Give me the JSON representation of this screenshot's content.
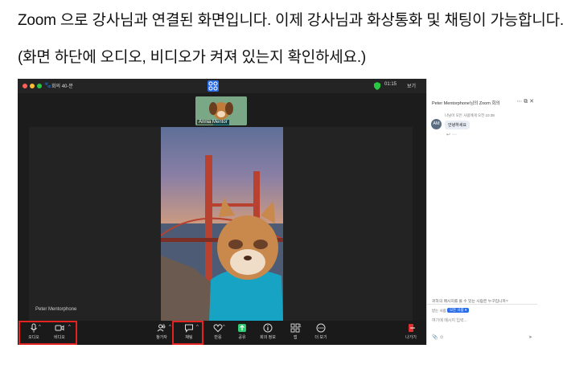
{
  "instructions": {
    "line1": "Zoom 으로 강사님과 연결된 화면입니다. 이제 강사님과 화상통화 및 채팅이 가능합니다.",
    "line2": "(화면 하단에 오디오, 비디오가 켜져 있는지 확인하세요.)"
  },
  "titlebar": {
    "timer": "회의 40-분",
    "clock": "01:15",
    "view": "보기"
  },
  "participant_thumb": {
    "name": "Annia Mentor"
  },
  "speaker_name": "Peter Mentorphone",
  "toolbar": {
    "audio": "오디오",
    "video": "비디오",
    "participants": "참가자",
    "participants_count": "2",
    "chat": "채팅",
    "react": "반응",
    "share": "공유",
    "info": "회의 정보",
    "apps": "앱",
    "apps_count": "1",
    "more": "더 보기",
    "leave": "나가기"
  },
  "chat_panel": {
    "title": "Peter Mentorphone님의 Zoom 회의",
    "avatar_initials": "AM",
    "message_meta": "나님이 모든 사람에게  오전 10:38",
    "message_text": "안녕하세요",
    "notice": "귀하의 메시지를 볼 수 있는 사람은 누구입니까?",
    "to_label": "받는 사람:",
    "to_value": "모든 사람 ▾",
    "input_placeholder": "여기에 메시지 입력..."
  },
  "colors": {
    "highlight_red": "#e32222",
    "share_green": "#2ecc71",
    "zoom_blue": "#2b6de8"
  }
}
